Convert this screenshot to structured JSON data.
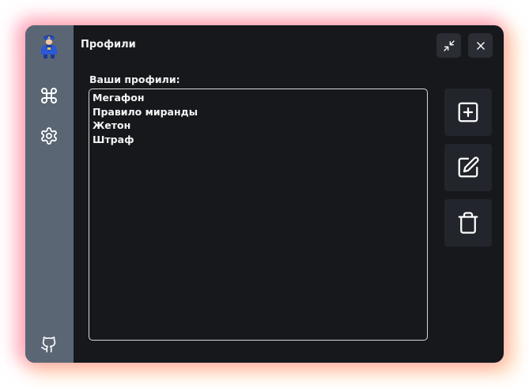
{
  "window": {
    "title": "Профили"
  },
  "sidebar": {
    "items": [
      {
        "icon": "police-officer-avatar-icon"
      },
      {
        "icon": "command-icon"
      },
      {
        "icon": "gear-icon"
      },
      {
        "icon": "github-icon"
      }
    ]
  },
  "titlebar": {
    "buttons": [
      {
        "icon": "collapse-arrows-icon"
      },
      {
        "icon": "close-icon"
      }
    ]
  },
  "profiles": {
    "label": "Ваши профили:",
    "items": [
      "Мегафон",
      "Правило миранды",
      "Жетон",
      "Штраф"
    ]
  },
  "actions": [
    {
      "icon": "plus-square-icon"
    },
    {
      "icon": "edit-icon"
    },
    {
      "icon": "trash-icon"
    }
  ],
  "colors": {
    "background": "#16181c",
    "sidebar": "#5b6675",
    "button": "#22252b",
    "text": "#f2f2f2",
    "glow_pink": "#ff6996",
    "glow_orange": "#ffbe78"
  }
}
